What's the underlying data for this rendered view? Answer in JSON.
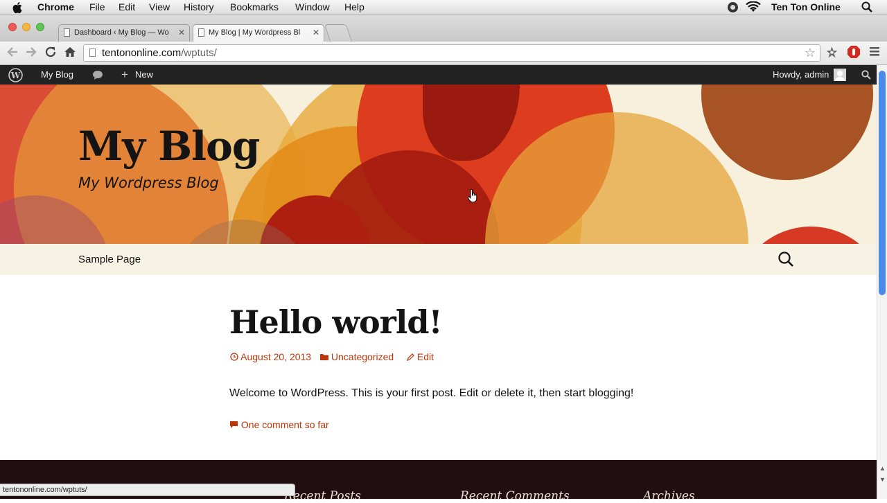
{
  "menubar": {
    "app": "Chrome",
    "items": [
      "File",
      "Edit",
      "View",
      "History",
      "Bookmarks",
      "Window",
      "Help"
    ],
    "user": "Ten Ton Online"
  },
  "tabs": [
    {
      "title": "Dashboard ‹ My Blog — Wo",
      "active": false
    },
    {
      "title": "My Blog | My Wordpress Bl",
      "active": true
    }
  ],
  "omnibox": {
    "host": "tentononline.com",
    "path": "/wptuts/"
  },
  "adminbar": {
    "site": "My Blog",
    "new": "New",
    "howdy": "Howdy, admin"
  },
  "site": {
    "title": "My Blog",
    "description": "My Wordpress Blog"
  },
  "nav": {
    "items": [
      "Sample Page"
    ]
  },
  "post": {
    "title": "Hello world!",
    "date": "August 20, 2013",
    "category": "Uncategorized",
    "edit": "Edit",
    "body": "Welcome to WordPress. This is your first post. Edit or delete it, then start blogging!",
    "comments": "One comment so far"
  },
  "footer": {
    "widgets": [
      "Recent Posts",
      "Recent Comments",
      "Archives"
    ]
  },
  "status": {
    "url": "tentononline.com/wptuts/"
  },
  "colors": {
    "accent": "#bc360a",
    "adminbar": "#222222",
    "footer": "#220e10"
  }
}
